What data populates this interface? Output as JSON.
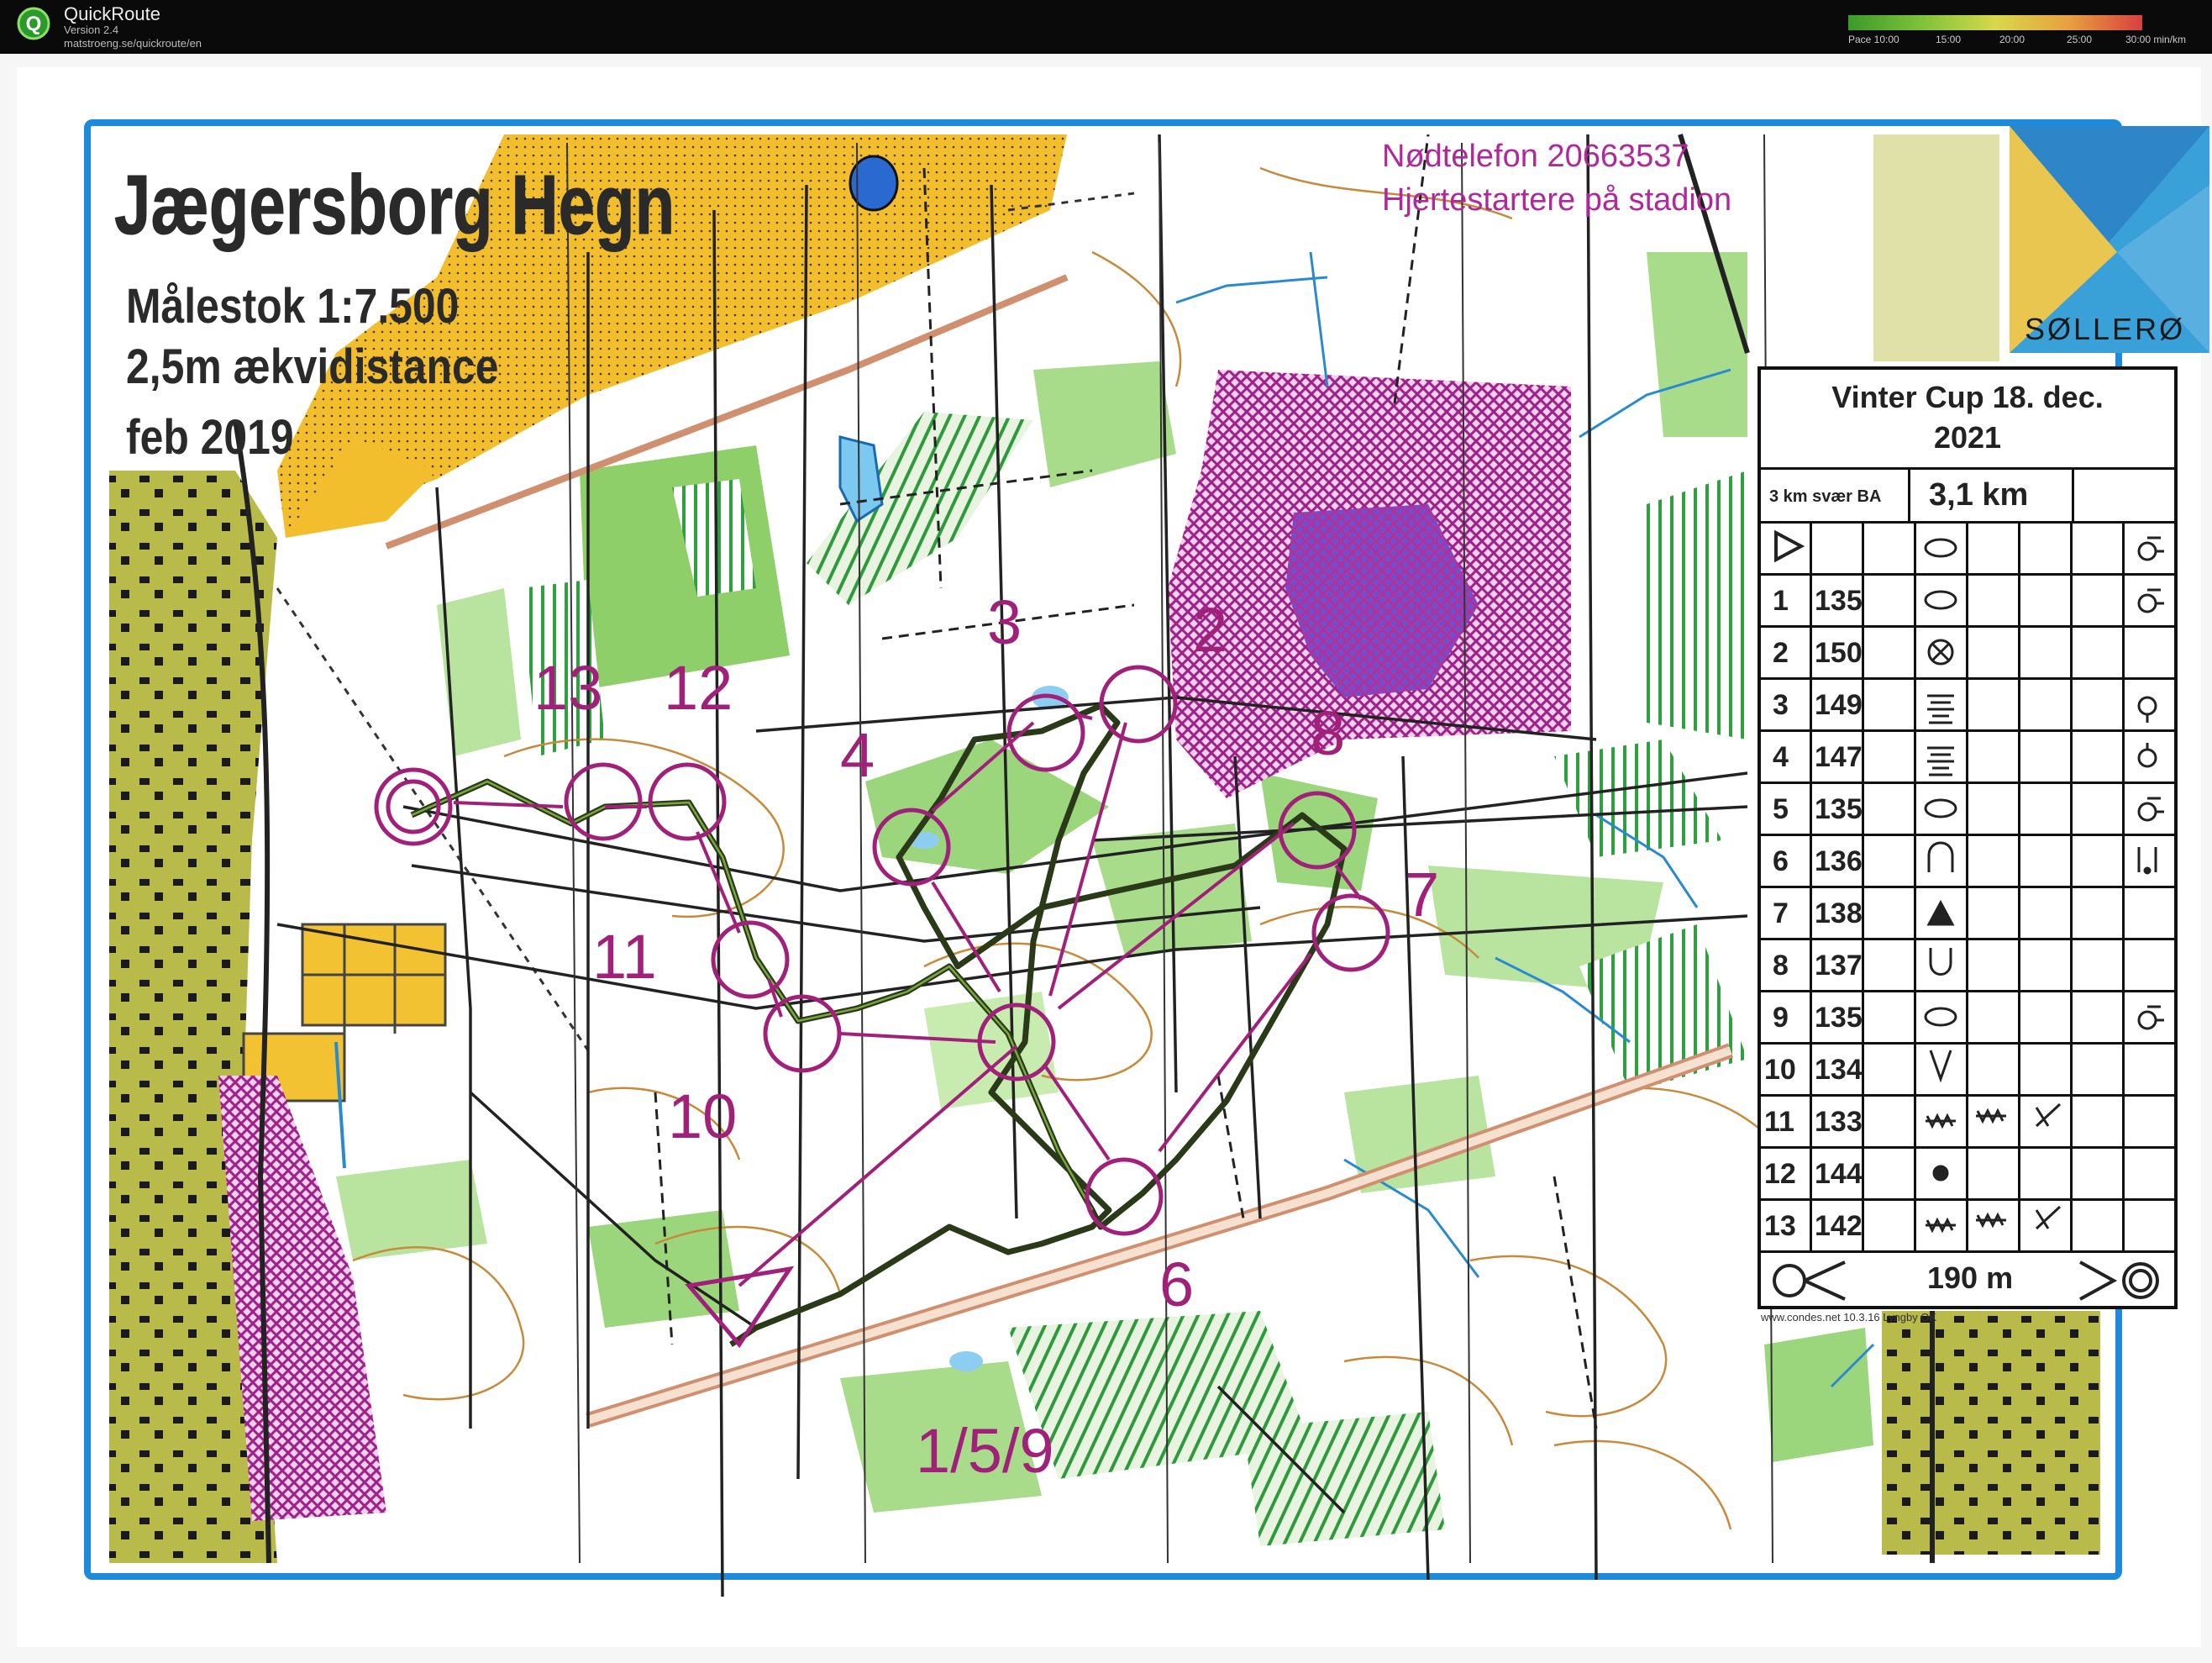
{
  "app": {
    "title": "QuickRoute",
    "version": "Version 2.4",
    "url": "matstroeng.se/quickroute/en",
    "logo_icon": "quickroute-q-icon"
  },
  "pace_scale": {
    "labels": [
      "Pace 10:00",
      "15:00",
      "20:00",
      "25:00",
      "30:00  min/km"
    ],
    "colors": [
      "#3a9a2a",
      "#7fc23a",
      "#d8d84a",
      "#e8a040",
      "#d84040"
    ]
  },
  "map": {
    "title": "Jægersborg Hegn",
    "scale": "Målestok 1:7.500",
    "contour": "2,5m ækvidistance",
    "date": "feb 2019",
    "emergency_phone": "Nødtelefon 20663537",
    "defibrillator": "Hjertestartere på stadion",
    "club_logo_text": "SØLLERØ",
    "controls": [
      {
        "label": "1/5/9"
      },
      {
        "label": "2"
      },
      {
        "label": "3"
      },
      {
        "label": "4"
      },
      {
        "label": "6"
      },
      {
        "label": "7"
      },
      {
        "label": "8"
      },
      {
        "label": "10"
      },
      {
        "label": "11"
      },
      {
        "label": "12"
      },
      {
        "label": "13"
      }
    ],
    "colors": {
      "course": "#a0207a",
      "route": "#2a3a18",
      "vegetation_green": "#8fcf6a",
      "yellow_open": "#f5c63c",
      "purple_out_of_bounds": "#b0289a",
      "water_blue": "#2a8ad0",
      "frame_blue": "#1e8adb"
    }
  },
  "description": {
    "event": "Vinter Cup 18. dec.",
    "year": "2021",
    "course_name": "3 km svær BA",
    "length": "3,1 km",
    "start_symbol": "start-triangle-icon",
    "rows": [
      {
        "num": "1",
        "code": "135"
      },
      {
        "num": "2",
        "code": "150"
      },
      {
        "num": "3",
        "code": "149"
      },
      {
        "num": "4",
        "code": "147"
      },
      {
        "num": "5",
        "code": "135"
      },
      {
        "num": "6",
        "code": "136"
      },
      {
        "num": "7",
        "code": "138"
      },
      {
        "num": "8",
        "code": "137"
      },
      {
        "num": "9",
        "code": "135"
      },
      {
        "num": "10",
        "code": "134"
      },
      {
        "num": "11",
        "code": "133"
      },
      {
        "num": "12",
        "code": "144"
      },
      {
        "num": "13",
        "code": "142"
      }
    ],
    "finish_distance": "190 m",
    "footer": "www.condes.net 10.3.16 Lyngby OK"
  }
}
